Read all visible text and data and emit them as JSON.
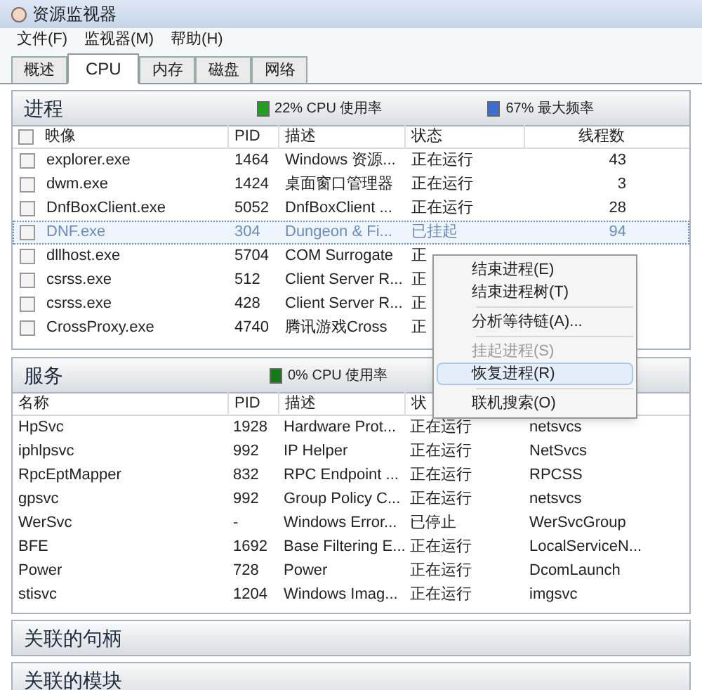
{
  "window": {
    "title": "资源监视器"
  },
  "menu": [
    "文件(F)",
    "监视器(M)",
    "帮助(H)"
  ],
  "tabs": [
    {
      "label": "概述",
      "selected": false
    },
    {
      "label": "CPU",
      "selected": true
    },
    {
      "label": "内存",
      "selected": false
    },
    {
      "label": "磁盘",
      "selected": false
    },
    {
      "label": "网络",
      "selected": false
    }
  ],
  "processes": {
    "title": "进程",
    "indicators": [
      {
        "text": "22% CPU 使用率",
        "color": "#1fa01f"
      },
      {
        "text": "67% 最大频率",
        "color": "#3a6fd0"
      }
    ],
    "columns": [
      "映像",
      "PID",
      "描述",
      "状态",
      "线程数"
    ],
    "select_all_checked": false,
    "rows": [
      {
        "name": "explorer.exe",
        "pid": "1464",
        "desc": "Windows 资源...",
        "status": "正在运行",
        "threads": "43",
        "checked": false,
        "selected": false
      },
      {
        "name": "dwm.exe",
        "pid": "1424",
        "desc": "桌面窗口管理器",
        "status": "正在运行",
        "threads": "3",
        "checked": false,
        "selected": false
      },
      {
        "name": "DnfBoxClient.exe",
        "pid": "5052",
        "desc": "DnfBoxClient ...",
        "status": "正在运行",
        "threads": "28",
        "checked": false,
        "selected": false
      },
      {
        "name": "DNF.exe",
        "pid": "304",
        "desc": "Dungeon & Fi...",
        "status": "已挂起",
        "threads": "94",
        "checked": false,
        "selected": true
      },
      {
        "name": "dllhost.exe",
        "pid": "5704",
        "desc": "COM Surrogate",
        "status": "正",
        "checked": false,
        "selected": false
      },
      {
        "name": "csrss.exe",
        "pid": "512",
        "desc": "Client Server R...",
        "status": "正",
        "checked": false,
        "selected": false
      },
      {
        "name": "csrss.exe",
        "pid": "428",
        "desc": "Client Server R...",
        "status": "正",
        "checked": false,
        "selected": false
      },
      {
        "name": "CrossProxy.exe",
        "pid": "4740",
        "desc": "腾讯游戏Cross",
        "status": "正",
        "checked": false,
        "selected": false
      }
    ]
  },
  "services": {
    "title": "服务",
    "indicators": [
      {
        "text": "0% CPU 使用率",
        "color": "#157a15"
      }
    ],
    "columns": [
      "名称",
      "PID",
      "描述",
      "状"
    ],
    "rows": [
      {
        "name": "HpSvc",
        "pid": "1928",
        "desc": "Hardware Prot...",
        "status": "正在运行",
        "group": "netsvcs"
      },
      {
        "name": "iphlpsvc",
        "pid": "992",
        "desc": "IP Helper",
        "status": "正在运行",
        "group": "NetSvcs"
      },
      {
        "name": "RpcEptMapper",
        "pid": "832",
        "desc": "RPC Endpoint ...",
        "status": "正在运行",
        "group": "RPCSS"
      },
      {
        "name": "gpsvc",
        "pid": "992",
        "desc": "Group Policy C...",
        "status": "正在运行",
        "group": "netsvcs"
      },
      {
        "name": "WerSvc",
        "pid": "-",
        "desc": "Windows Error...",
        "status": "已停止",
        "group": "WerSvcGroup"
      },
      {
        "name": "BFE",
        "pid": "1692",
        "desc": "Base Filtering E...",
        "status": "正在运行",
        "group": "LocalServiceN..."
      },
      {
        "name": "Power",
        "pid": "728",
        "desc": "Power",
        "status": "正在运行",
        "group": "DcomLaunch"
      },
      {
        "name": "stisvc",
        "pid": "1204",
        "desc": "Windows Imag...",
        "status": "正在运行",
        "group": "imgsvc"
      }
    ]
  },
  "collapsed_sections": [
    "关联的句柄",
    "关联的模块"
  ],
  "context_menu": [
    {
      "kind": "item",
      "label": "结束进程(E)",
      "disabled": false,
      "selected": false
    },
    {
      "kind": "item",
      "label": "结束进程树(T)",
      "disabled": false,
      "selected": false
    },
    {
      "kind": "separator"
    },
    {
      "kind": "item",
      "label": "分析等待链(A)...",
      "disabled": false,
      "selected": false
    },
    {
      "kind": "separator"
    },
    {
      "kind": "item",
      "label": "挂起进程(S)",
      "disabled": true,
      "selected": false
    },
    {
      "kind": "item",
      "label": "恢复进程(R)",
      "disabled": false,
      "selected": true
    },
    {
      "kind": "separator"
    },
    {
      "kind": "item",
      "label": "联机搜索(O)",
      "disabled": false,
      "selected": false
    }
  ]
}
